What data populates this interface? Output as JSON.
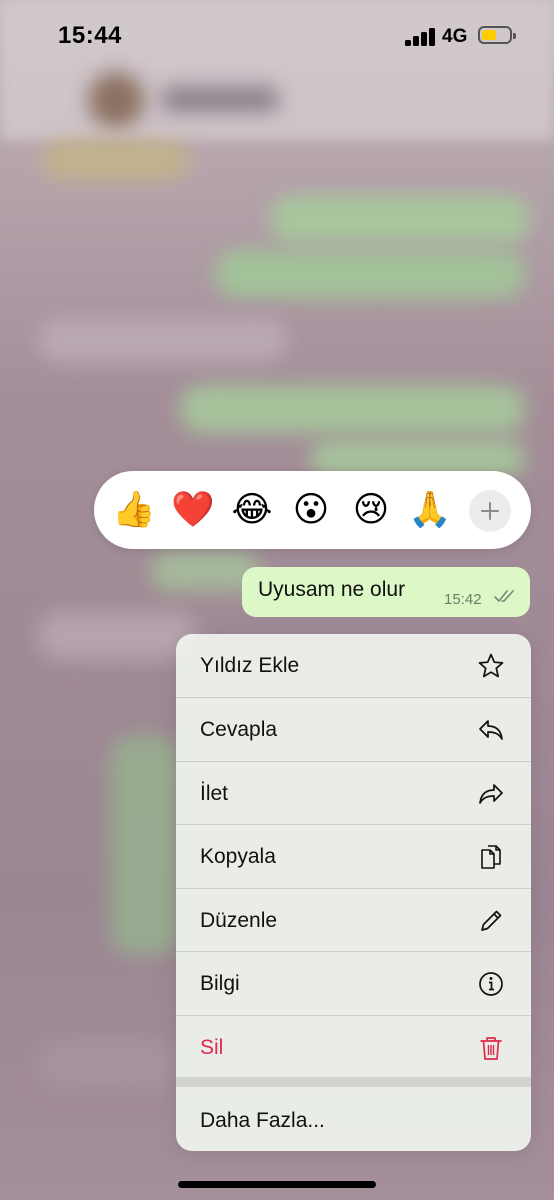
{
  "status_bar": {
    "time": "15:44",
    "network": "4G",
    "battery_level": 0.55,
    "battery_color": "#ffcc00"
  },
  "reactions": {
    "emojis": [
      "👍",
      "❤️",
      "😂",
      "😮",
      "😢",
      "🙏"
    ],
    "more_icon": "plus-icon"
  },
  "message": {
    "text": "Uyusam ne olur",
    "time": "15:42",
    "status_icon": "double-check-icon",
    "bubble_color": "#dcf8c6"
  },
  "menu": {
    "items": [
      {
        "label": "Yıldız Ekle",
        "icon": "star-icon"
      },
      {
        "label": "Cevapla",
        "icon": "reply-icon"
      },
      {
        "label": "İlet",
        "icon": "forward-icon"
      },
      {
        "label": "Kopyala",
        "icon": "copy-icon"
      },
      {
        "label": "Düzenle",
        "icon": "pencil-icon"
      },
      {
        "label": "Bilgi",
        "icon": "info-icon"
      },
      {
        "label": "Sil",
        "icon": "trash-icon"
      }
    ],
    "more_label": "Daha Fazla...",
    "destructive_color": "#e0294c"
  }
}
